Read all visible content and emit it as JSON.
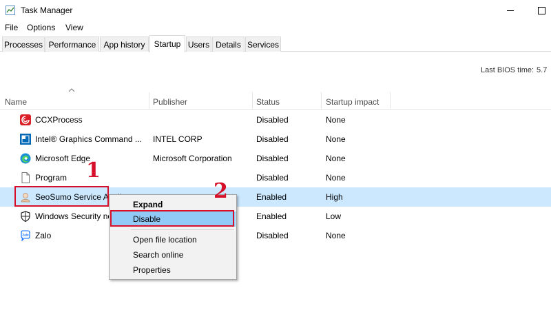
{
  "window": {
    "title": "Task Manager"
  },
  "menu": [
    "File",
    "Options",
    "View"
  ],
  "tabs": [
    "Processes",
    "Performance",
    "App history",
    "Startup",
    "Users",
    "Details",
    "Services"
  ],
  "active_tab": "Startup",
  "bios": {
    "label": "Last BIOS time:",
    "value": "5.7"
  },
  "columns": [
    "Name",
    "Publisher",
    "Status",
    "Startup impact"
  ],
  "rows": [
    {
      "icon": "ccx-icon",
      "name": "CCXProcess",
      "publisher": "",
      "status": "Disabled",
      "impact": "None"
    },
    {
      "icon": "intel-graphics-icon",
      "name": "Intel® Graphics Command ...",
      "publisher": "INTEL CORP",
      "status": "Disabled",
      "impact": "None"
    },
    {
      "icon": "edge-icon",
      "name": "Microsoft Edge",
      "publisher": "Microsoft Corporation",
      "status": "Disabled",
      "impact": "None"
    },
    {
      "icon": "document-icon",
      "name": "Program",
      "publisher": "",
      "status": "Disabled",
      "impact": "None"
    },
    {
      "icon": "seosumo-icon",
      "name": "SeoSumo Service Appli...",
      "publisher": "",
      "status": "Enabled",
      "impact": "High"
    },
    {
      "icon": "shield-icon",
      "name": "Windows Security no...",
      "publisher": "",
      "status": "Enabled",
      "impact": "Low"
    },
    {
      "icon": "zalo-icon",
      "name": "Zalo",
      "publisher": "",
      "status": "Disabled",
      "impact": "None"
    }
  ],
  "context_menu": {
    "expand": "Expand",
    "disable": "Disable",
    "open_file_location": "Open file location",
    "search_online": "Search online",
    "properties": "Properties"
  },
  "annotations": {
    "step1": "1",
    "step2": "2"
  },
  "colors": {
    "selection": "#cce8ff",
    "menu_highlight": "#91c9f7",
    "annotation": "#d6102a"
  }
}
